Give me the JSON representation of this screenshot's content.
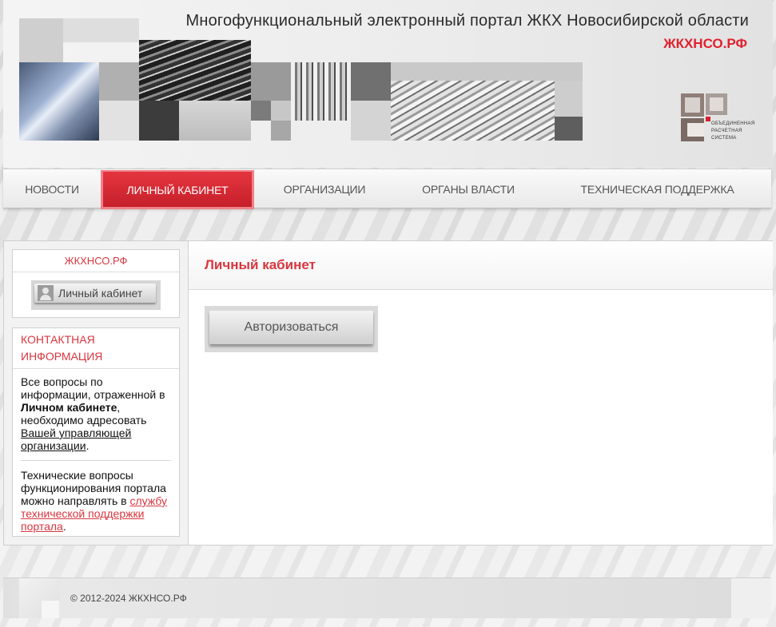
{
  "header": {
    "site_title": "Многофункциональный электронный портал ЖКХ Новосибирской области",
    "brand": "ЖКХНСО.РФ",
    "logo_lines": [
      "ОБЪЕДИНЕННАЯ",
      "РАСЧЕТНАЯ",
      "СИСТЕМА"
    ]
  },
  "nav": {
    "items": [
      {
        "label": "Новости"
      },
      {
        "label": "Личный кабинет",
        "active": true
      },
      {
        "label": "Организации"
      },
      {
        "label": "Органы власти"
      },
      {
        "label": "Техническая поддержка"
      }
    ]
  },
  "sidebar": {
    "panel_title": "ЖКХНСО.РФ",
    "cabinet_button": "Личный кабинет",
    "contact": {
      "title": "Контактная информация",
      "p1_before": "Все вопросы по информации, отраженной в ",
      "p1_bold": "Личном кабинете",
      "p1_middle": ", необходимо адресовать ",
      "p1_link": "Вашей управляющей организации",
      "p1_end": ".",
      "p2_before": "Технические вопросы функционирования портала можно направлять в ",
      "p2_link": "службу технической поддержки портала",
      "p2_end": "."
    }
  },
  "content": {
    "title": "Личный кабинет",
    "auth_button": "Авторизоваться"
  },
  "footer": {
    "copyright": "© 2012-2024 ЖКХНСО.РФ"
  },
  "colors": {
    "accent": "#d9363f",
    "nav_active": "#d0242f"
  }
}
